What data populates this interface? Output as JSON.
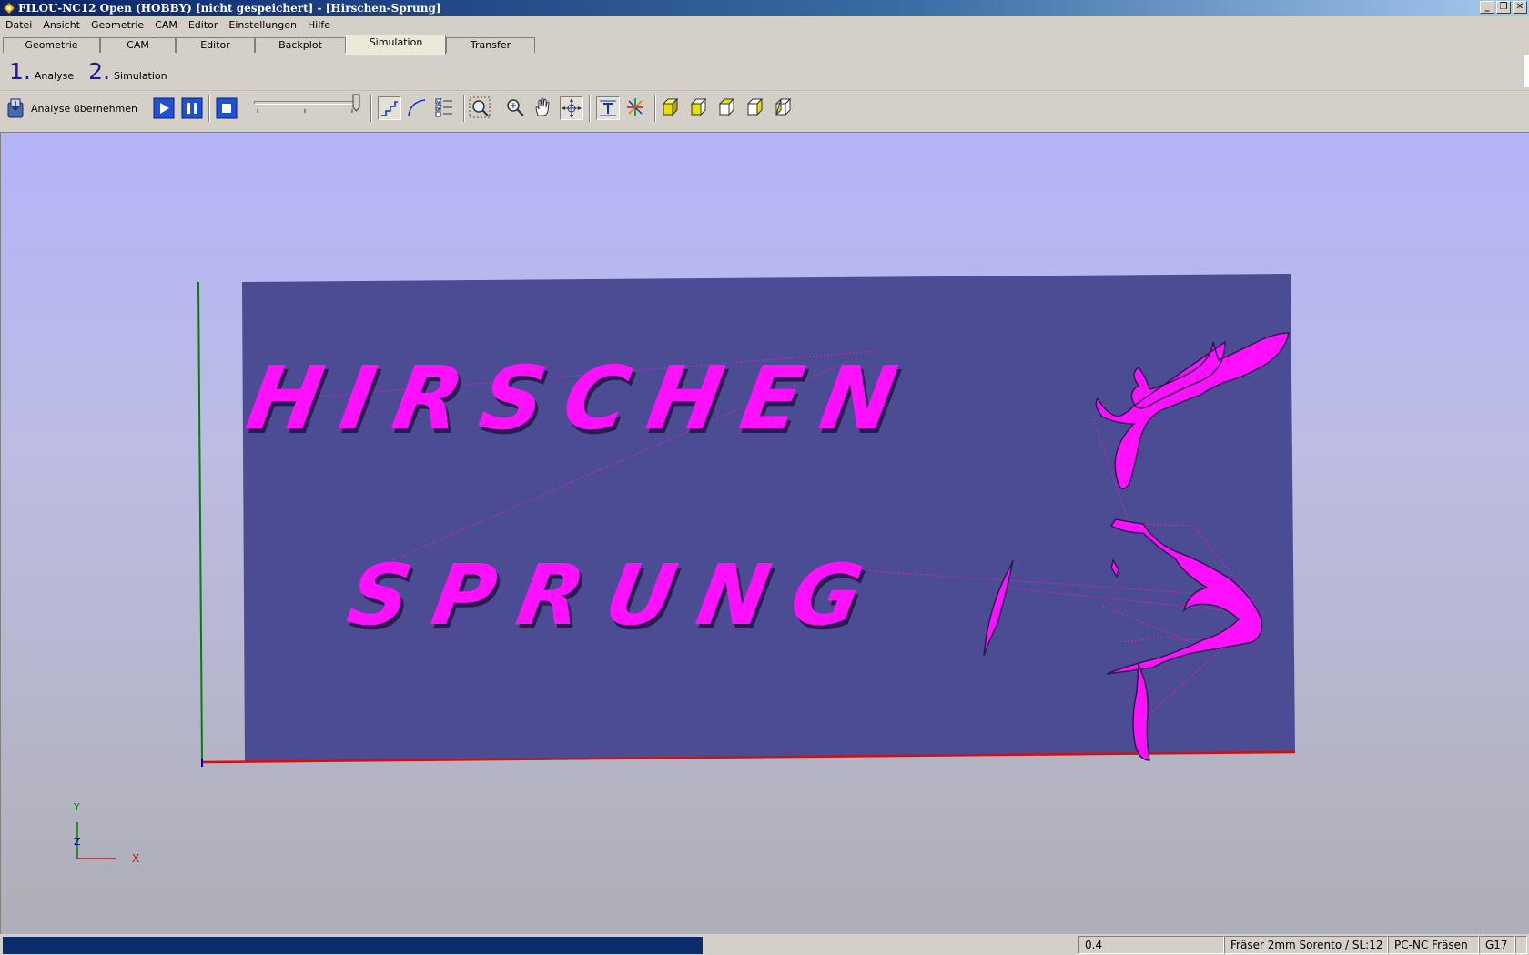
{
  "window": {
    "title": "FILOU-NC12 Open (HOBBY)  [nicht gespeichert] - [Hirschen-Sprung]",
    "buttons": {
      "minimize": "_",
      "maximize": "❐",
      "close": "✕"
    }
  },
  "menu": [
    "Datei",
    "Ansicht",
    "Geometrie",
    "CAM",
    "Editor",
    "Einstellungen",
    "Hilfe"
  ],
  "tabs": [
    "Geometrie",
    "CAM",
    "Editor",
    "Backplot",
    "Simulation",
    "Transfer"
  ],
  "active_tab": "Simulation",
  "steps": [
    {
      "num": "1.",
      "label": "Analyse"
    },
    {
      "num": "2.",
      "label": "Simulation"
    }
  ],
  "toolbar": {
    "analyse_button": "Analyse übernehmen",
    "speed_slider": 1.0
  },
  "viewport": {
    "texts": {
      "line1": "HIRSCHEN",
      "line2": "SPRUNG"
    },
    "axis_labels": {
      "x": "X",
      "y": "Y",
      "z": "Z"
    },
    "colors": {
      "stock": "#4c4c94",
      "toolpath": "#ff00ff",
      "x_axis": "#d01010",
      "y_axis": "#008000",
      "z_axis": "#0000c0"
    }
  },
  "status": {
    "progress": 0.46,
    "value": "0.4",
    "tool": "Fräser 2mm Sorento / SL:12",
    "machine": "PC-NC Fräsen",
    "plane": "G17"
  }
}
